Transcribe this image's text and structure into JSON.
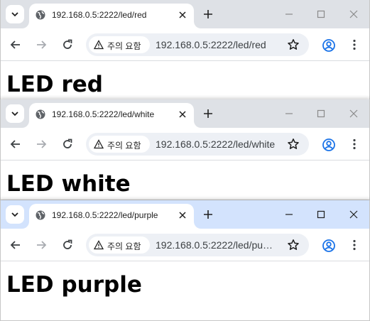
{
  "security_label": "주의 요함",
  "colors": {
    "tabstrip": "#dee1e6",
    "tabstrip_active": "#d3e3fd",
    "omnibox": "#edf0f5",
    "profile": "#1a73e8"
  },
  "windows": [
    {
      "tab_title": "192.168.0.5:2222/led/red",
      "url": "192.168.0.5:2222/led/red",
      "heading": "LED red"
    },
    {
      "tab_title": "192.168.0.5:2222/led/white",
      "url": "192.168.0.5:2222/led/white",
      "heading": "LED white"
    },
    {
      "tab_title": "192.168.0.5:2222/led/purple",
      "url": "192.168.0.5:2222/led/purple",
      "heading": "LED purple"
    }
  ]
}
